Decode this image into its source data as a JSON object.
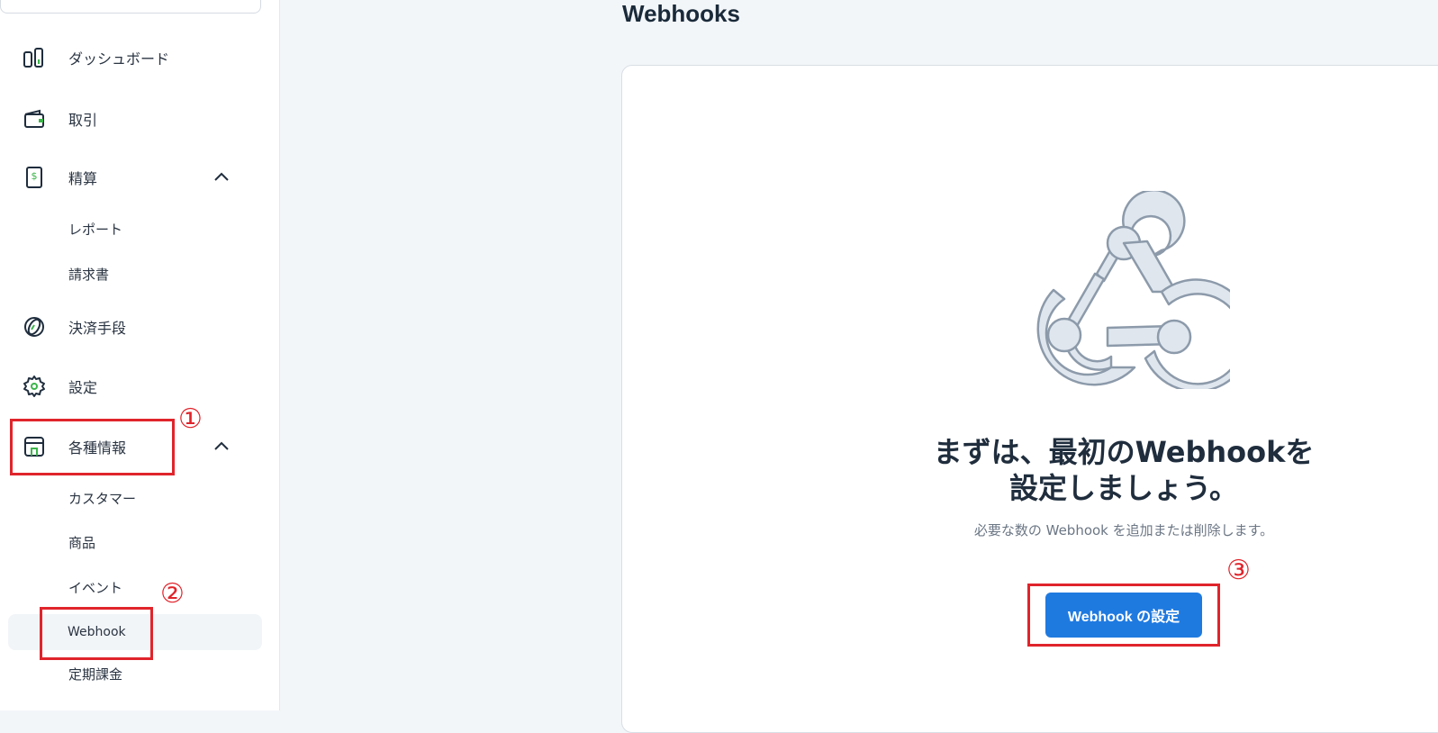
{
  "sidebar": {
    "items": [
      {
        "label": "ダッシュボード",
        "icon": "dashboard-icon"
      },
      {
        "label": "取引",
        "icon": "wallet-icon"
      },
      {
        "label": "精算",
        "icon": "dollar-document-icon",
        "expanded": true,
        "children": [
          {
            "label": "レポート"
          },
          {
            "label": "請求書"
          }
        ]
      },
      {
        "label": "決済手段",
        "icon": "card-icon"
      },
      {
        "label": "設定",
        "icon": "gear-icon"
      },
      {
        "label": "各種情報",
        "icon": "store-icon",
        "expanded": true,
        "children": [
          {
            "label": "カスタマー"
          },
          {
            "label": "商品"
          },
          {
            "label": "イベント"
          },
          {
            "label": "Webhook",
            "active": true
          },
          {
            "label": "定期課金"
          }
        ]
      }
    ]
  },
  "page": {
    "title": "Webhooks"
  },
  "empty_state": {
    "icon": "webhook-icon",
    "title_line1": "まずは、最初のWebhookを",
    "title_line2": "設定しましょう。",
    "subtitle": "必要な数の Webhook を追加または削除します。",
    "button_label": "Webhook の設定"
  },
  "annotations": {
    "step1": "①",
    "step2": "②",
    "step3": "③"
  },
  "colors": {
    "accent": "#1f7ae0",
    "annotation": "#e0242b",
    "icon_green": "#3bb54a"
  }
}
